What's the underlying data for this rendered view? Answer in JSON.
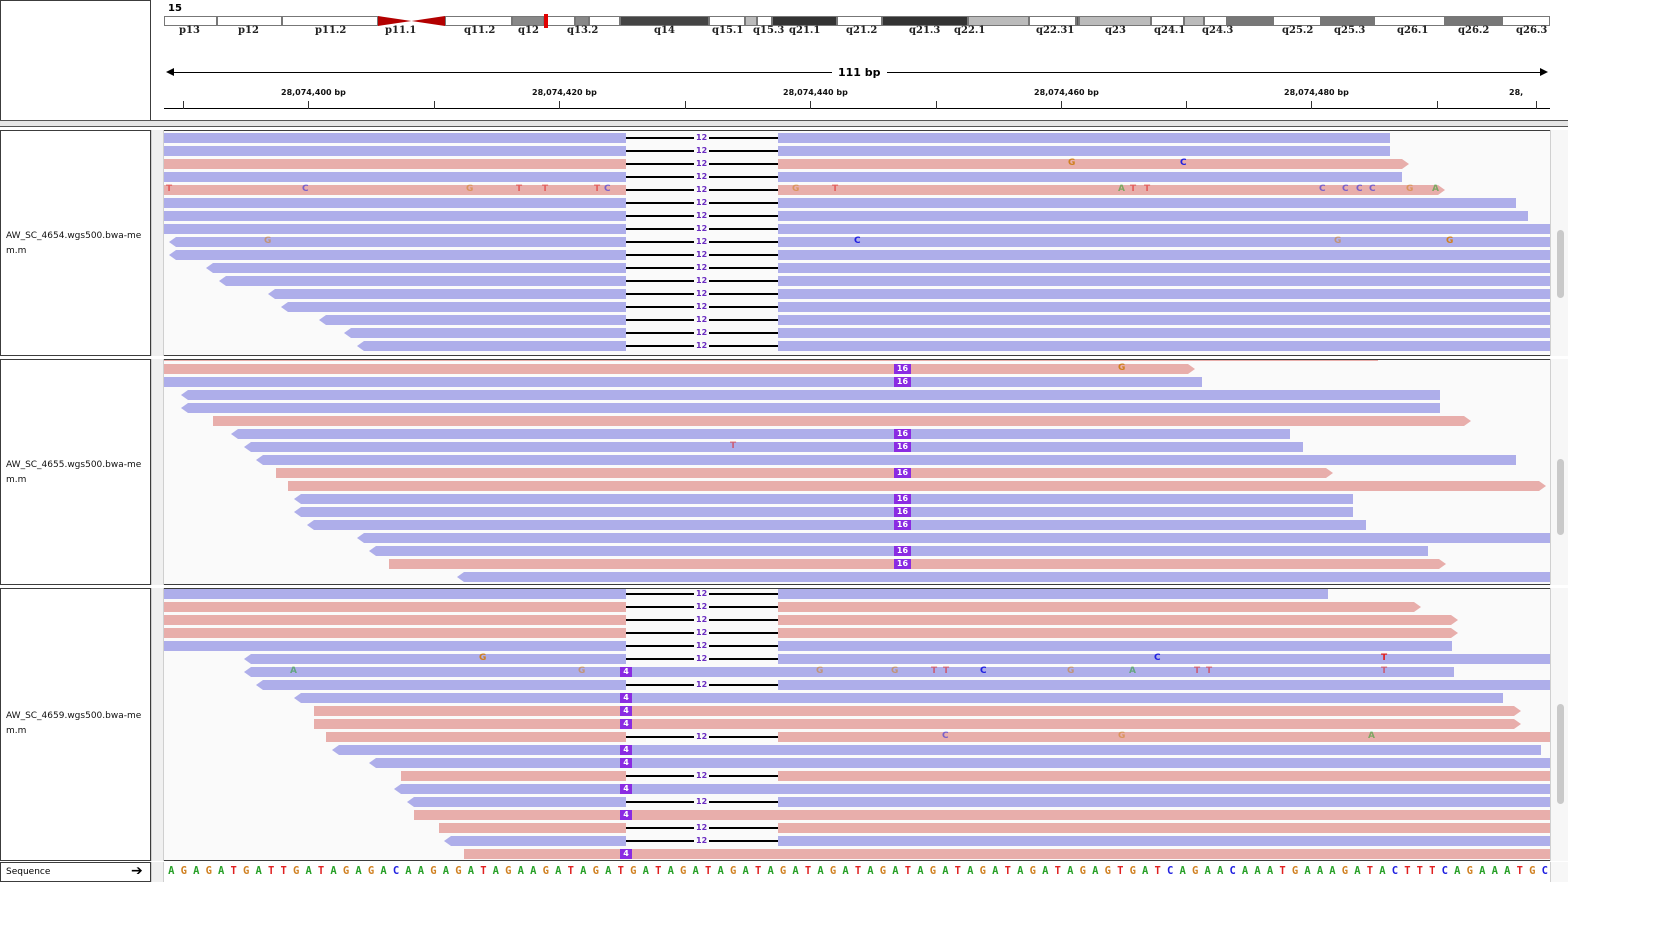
{
  "chromosome": "15",
  "ideogram_bands": [
    "p13",
    "p12",
    "p11.2",
    "p11.1",
    "q11.2",
    "q12",
    "q13.2",
    "q14",
    "q15.1",
    "q15.3",
    "q21.1",
    "q21.2",
    "q21.3",
    "q22.1",
    "q22.31",
    "q23",
    "q24.1",
    "q24.3",
    "q25.2",
    "q25.3",
    "q26.1",
    "q26.2",
    "q26.3"
  ],
  "span_label": "111 bp",
  "ruler_ticks": [
    "28,074,400 bp",
    "28,074,420 bp",
    "28,074,440 bp",
    "28,074,460 bp",
    "28,074,480 bp",
    "28,"
  ],
  "tracks": [
    {
      "name": "AW_SC_4654.wgs500.bwa-mem.m"
    },
    {
      "name": "AW_SC_4655.wgs500.bwa-mem.m"
    },
    {
      "name": "AW_SC_4659.wgs500.bwa-mem.m"
    }
  ],
  "deletion_label": "12",
  "insertion_labels": {
    "long": "16",
    "short": "4"
  },
  "sequence_label": "Sequence",
  "reference_sequence": "AGAGATGATTGATAGAGACAAGAGATAGAAGATAGATGATAGATAGATAGATAGATAGATAGATAGATAGATAGAGTGATCAGAACAAATGAAAGATACTTTCAGAAATGC",
  "colors": {
    "forward_read": "#e8aeab",
    "reverse_read": "#aeaeea",
    "insertion": "#8a2be2",
    "cytoband_centromere": "#b30000"
  }
}
